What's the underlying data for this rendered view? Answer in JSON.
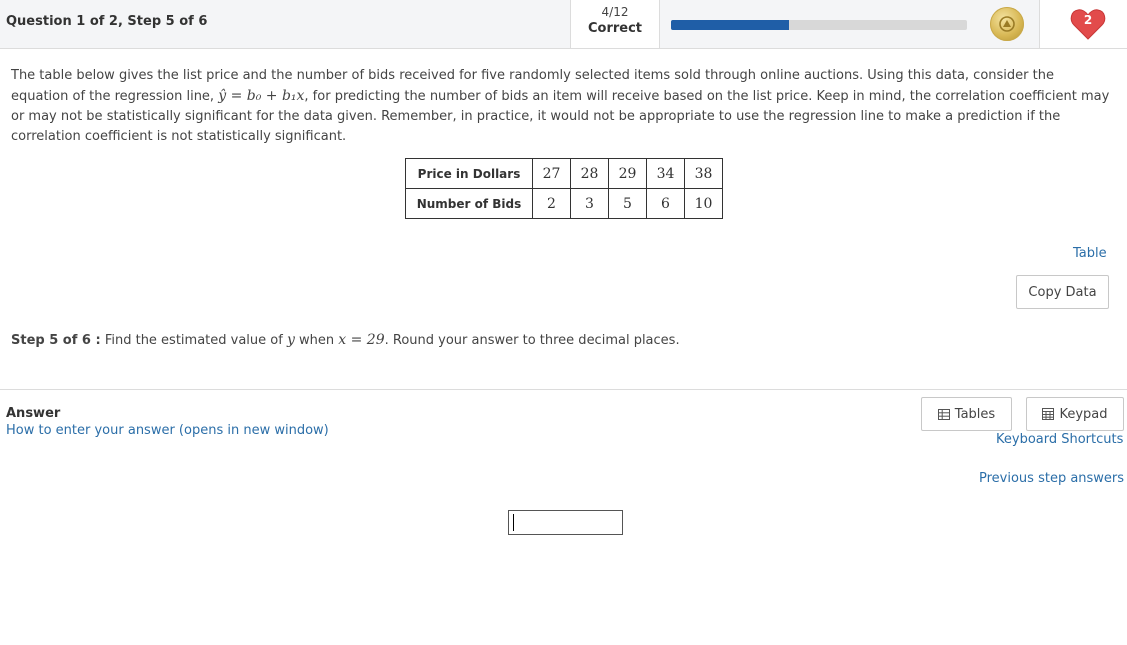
{
  "header": {
    "question_step": "Question 1 of 2, Step 5 of 6",
    "score_fraction": "4/12",
    "score_label": "Correct",
    "progress_fraction": 0.4,
    "coin_icon": "coin-badge-icon",
    "hearts_count": "2",
    "colors": {
      "progress": "#1f5ea7",
      "heart": "#e24b4b",
      "link": "#2b6ea8"
    }
  },
  "problem": {
    "text_1": "The table below gives the list price and the number of bids received for five randomly selected items sold through online auctions. Using this data, consider the equation of the regression line,",
    "equation": "ŷ = b₀ + b₁x",
    "text_2": ", for predicting the number of bids an item will receive based on the list price. Keep in mind, the correlation coefficient may or may not be statistically significant for the data given. Remember, in practice, it would not be appropriate to use the regression line to make a prediction if the correlation coefficient is not statistically significant."
  },
  "data_table": {
    "rows": [
      {
        "header": "Price in Dollars",
        "values": [
          "27",
          "28",
          "29",
          "34",
          "38"
        ]
      },
      {
        "header": "Number of Bids",
        "values": [
          "2",
          "3",
          "5",
          "6",
          "10"
        ]
      }
    ]
  },
  "table_tools": {
    "table_link": "Table",
    "copy_data": "Copy Data"
  },
  "step": {
    "label": "Step 5 of 6 :",
    "text_a": "Find the estimated value of",
    "var_y": "y",
    "text_b": "when",
    "equation": "x = 29",
    "text_c": ". Round your answer to three decimal places."
  },
  "answer": {
    "label": "Answer",
    "howto": "How to enter your answer (opens in new window)",
    "tables_btn": "Tables",
    "keypad_btn": "Keypad",
    "keyboard_shortcuts": "Keyboard Shortcuts",
    "previous_answers": "Previous step answers",
    "input_value": ""
  }
}
